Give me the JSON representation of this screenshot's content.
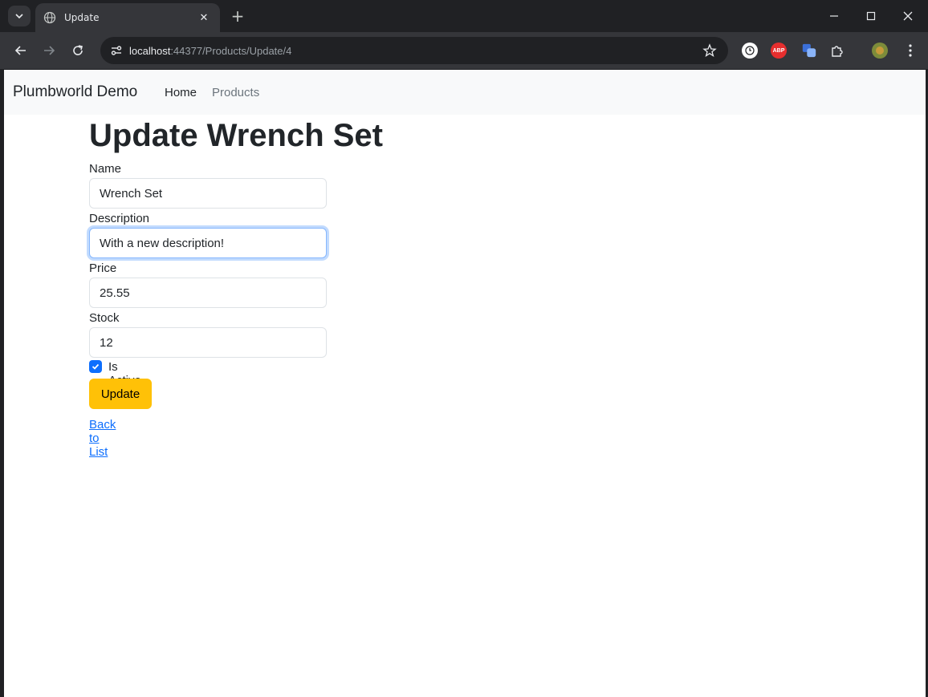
{
  "browser": {
    "tab_title": "Update",
    "url_host": "localhost",
    "url_path": ":44377/Products/Update/4",
    "ext_abp": "ABP"
  },
  "navbar": {
    "brand": "Plumbworld Demo",
    "links": [
      "Home",
      "Products"
    ]
  },
  "form": {
    "heading": "Update Wrench Set",
    "name_label": "Name",
    "name_value": "Wrench Set",
    "description_label": "Description",
    "description_value": "With a new description!",
    "price_label": "Price",
    "price_value": "25.55",
    "stock_label": "Stock",
    "stock_value": "12",
    "is_active_label": "Is Active",
    "is_active": true,
    "submit_label": "Update",
    "back_link": "Back to List"
  },
  "colors": {
    "accent": "#0d6efd",
    "update_button": "#ffc107",
    "navbar_bg": "#f8f9fa"
  }
}
